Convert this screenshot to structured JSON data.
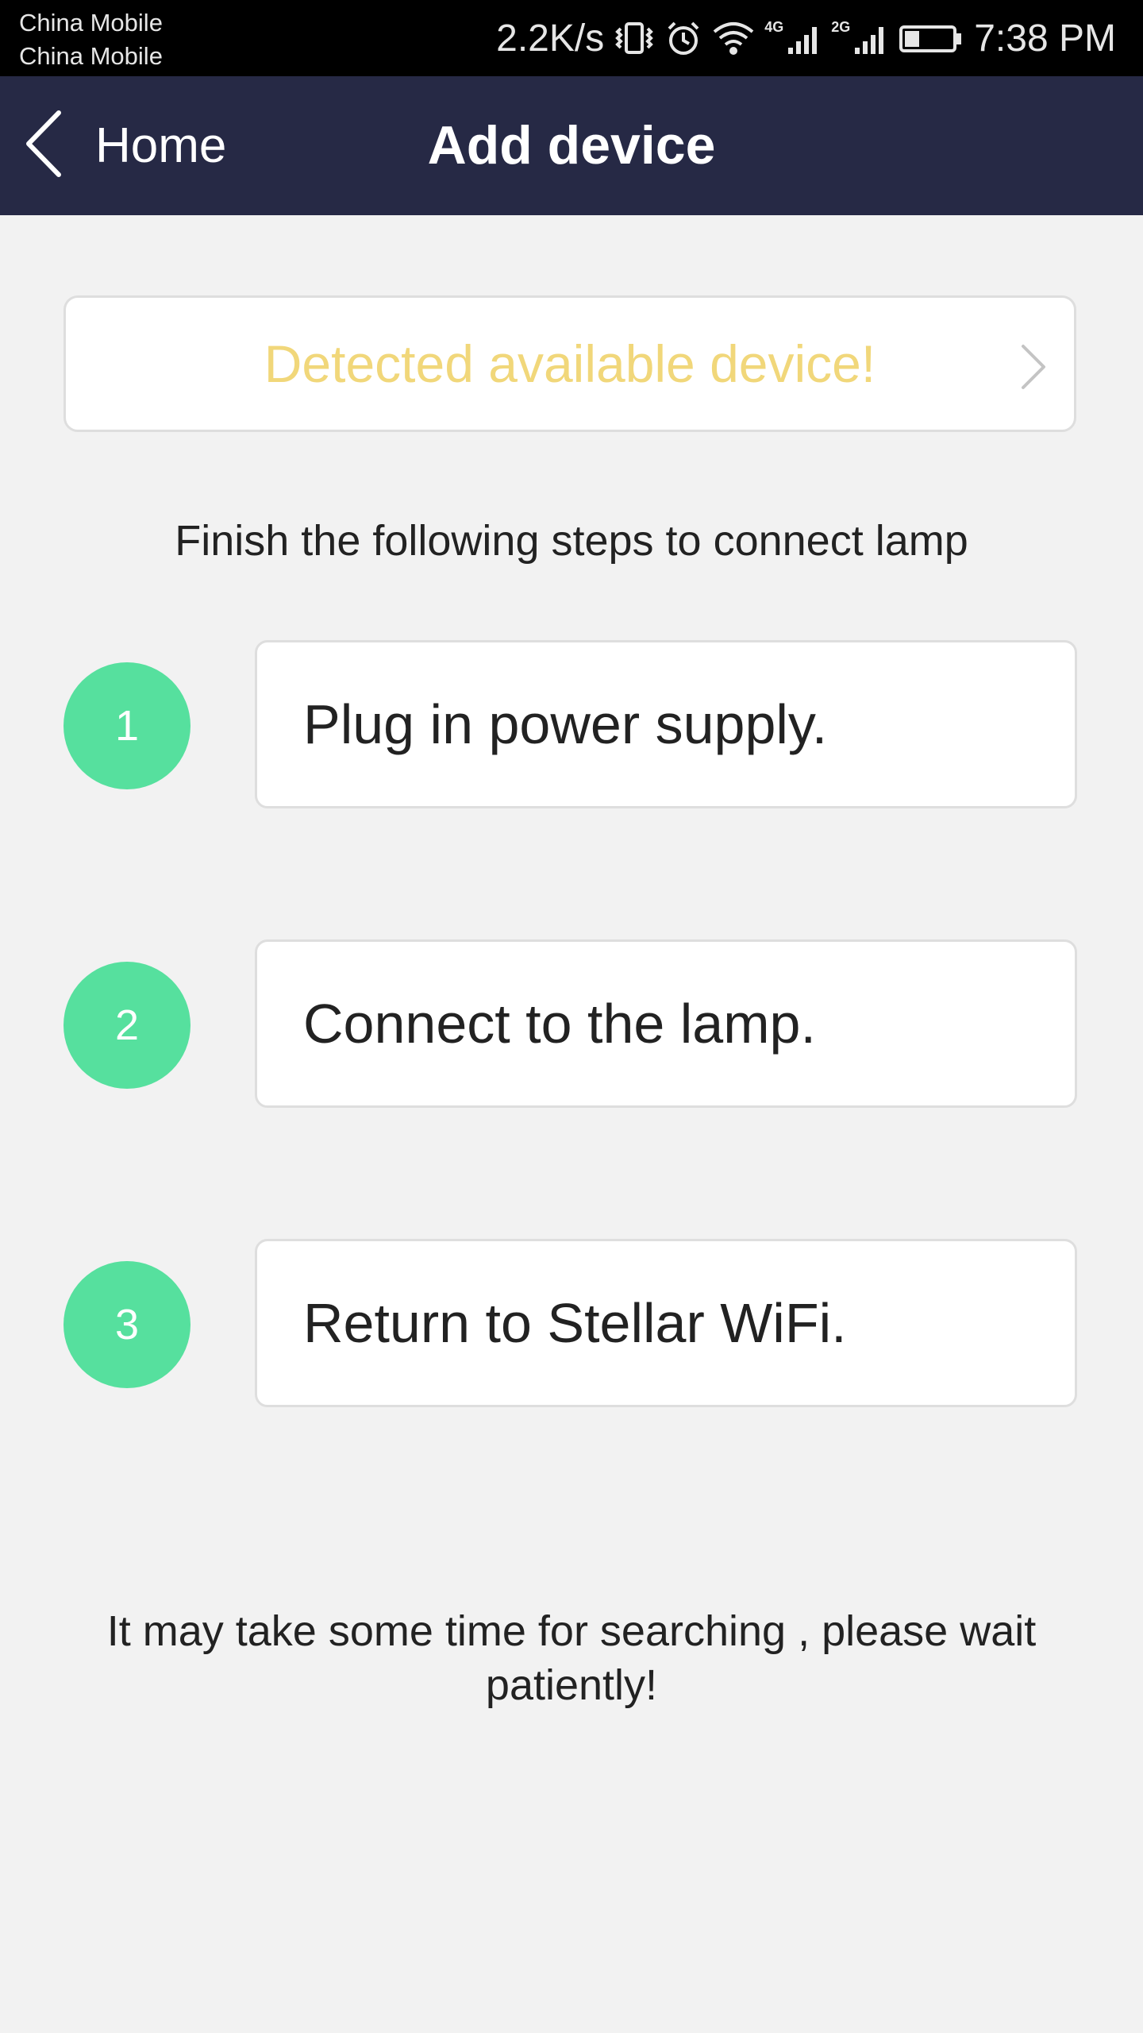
{
  "status_bar": {
    "carrier_1": "China Mobile",
    "carrier_2": "China Mobile",
    "net_speed": "2.2K/s",
    "net_type_1": "4G",
    "net_type_2": "2G",
    "time": "7:38 PM",
    "icons": [
      "vibrate-icon",
      "alarm-icon",
      "wifi-icon",
      "signal-icon",
      "signal-icon",
      "battery-icon"
    ]
  },
  "app_bar": {
    "back_label": "Home",
    "title": "Add device",
    "background_color": "#262945"
  },
  "detected_banner": {
    "text": "Detected available device!",
    "text_color": "#f1d77a",
    "icon": "chevron-right-icon"
  },
  "instruction": "Finish the following steps to connect lamp",
  "steps": [
    {
      "number": "1",
      "text": "Plug in power supply."
    },
    {
      "number": "2",
      "text": "Connect to the lamp."
    },
    {
      "number": "3",
      "text": "Return to Stellar WiFi."
    }
  ],
  "step_circle_color": "#56e09e",
  "footer_note": "It may take some time for searching , please wait patiently!"
}
